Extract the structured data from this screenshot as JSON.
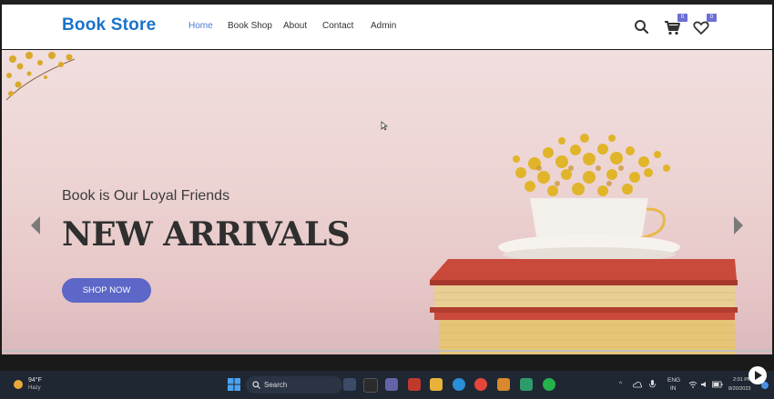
{
  "navbar": {
    "logo": "Book Store",
    "links": [
      {
        "label": "Home",
        "active": true
      },
      {
        "label": "Book Shop",
        "active": false
      },
      {
        "label": "About",
        "active": false
      },
      {
        "label": "Contact",
        "active": false
      },
      {
        "label": "Admin",
        "active": false
      }
    ],
    "cart_count": "0",
    "wishlist_count": "0",
    "icons": [
      "search-icon",
      "cart-icon",
      "heart-icon"
    ]
  },
  "hero": {
    "subtitle": "Book is Our Loyal Friends",
    "title": "NEW ARRIVALS",
    "button_label": "SHOP NOW"
  },
  "taskbar": {
    "weather_temp": "94°F",
    "weather_condition": "Hazy",
    "search_label": "Search",
    "language": "ENG",
    "region": "IN",
    "time": "2:01 PM",
    "date": "8/20/2023"
  },
  "colors": {
    "brand": "#1a73c9",
    "accent": "#5c67c8",
    "active_link": "#4a7ad6"
  }
}
